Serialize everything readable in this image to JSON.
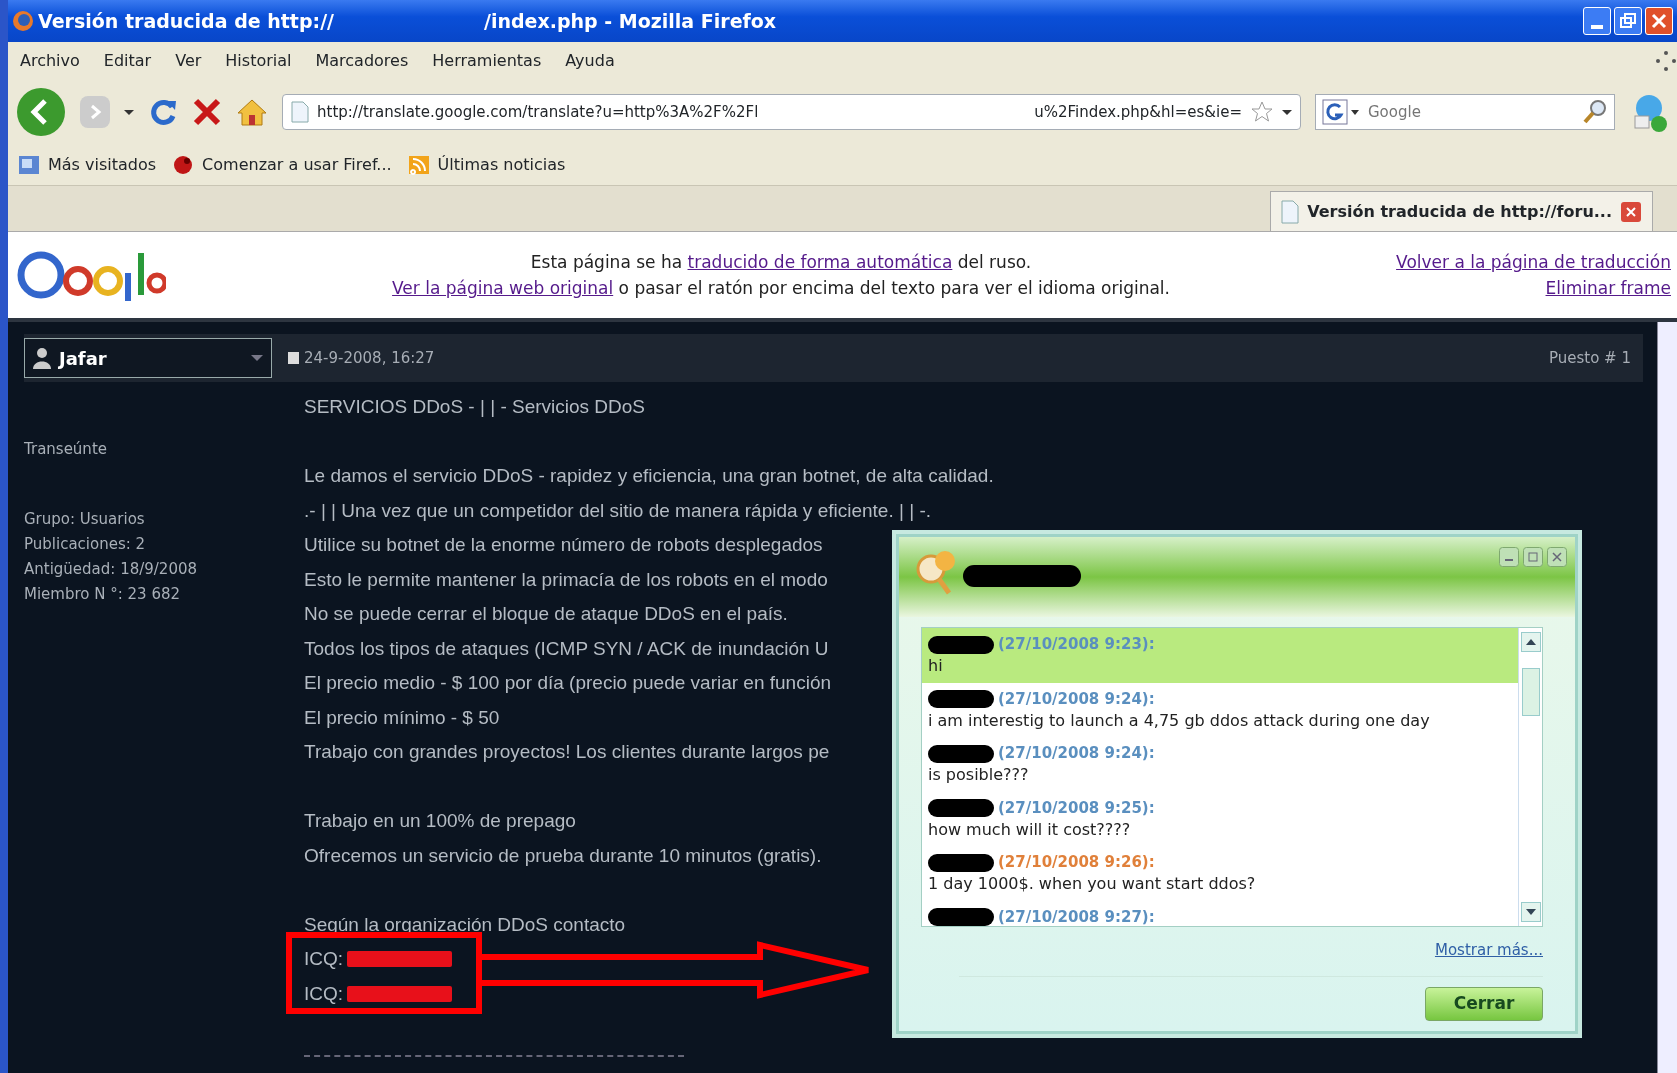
{
  "window": {
    "title_start": "Versión traducida de http://",
    "title_end": "/index.php - Mozilla Firefox"
  },
  "menu": [
    "Archivo",
    "Editar",
    "Ver",
    "Historial",
    "Marcadores",
    "Herramientas",
    "Ayuda"
  ],
  "toolbar": {
    "url_start": "http://translate.google.com/translate?u=http%3A%2F%2Fl",
    "url_end": "u%2Findex.php&hl=es&ie=",
    "search_placeholder": "Google"
  },
  "bookmarks": [
    "Más visitados",
    "Comenzar a usar Firef...",
    "Últimas noticias"
  ],
  "tabs": [
    {
      "label": "Versión traducida de http://foru...",
      "selected": true
    }
  ],
  "google_bar": {
    "line1_before": "Esta página se ha ",
    "line1_link": "traducido de forma automática",
    "line1_after": " del ruso.",
    "line2_link": "Ver la página web original",
    "line2_after": " o pasar el ratón por encima del texto para ver el idioma original.",
    "links": [
      "Volver a la página de traducción",
      "Eliminar frame"
    ]
  },
  "post": {
    "author": "Jafar",
    "date": "24-9-2008, 16:27",
    "number": "Puesto # 1",
    "rank": "Transeúnte",
    "details": [
      "Grupo: Usuarios",
      "Publicaciones: 2",
      "Antigüedad: 18/9/2008",
      "Miembro N °: 23 682"
    ],
    "paragraphs": [
      [
        {
          "kind": "text",
          "text": "SERVICIOS DDoS - | | - Servicios DDoS"
        }
      ],
      [
        {
          "kind": "text",
          "text": "Le damos el servicio DDoS - rapidez y eficiencia, una gran botnet, de alta calidad."
        },
        {
          "kind": "text",
          "text": ".- | | Una vez que un competidor del sitio de manera rápida y eficiente. | | -."
        },
        {
          "kind": "text",
          "text": "Utilice su botnet de la enorme número de robots desplegados"
        },
        {
          "kind": "text",
          "text": "Esto le permite mantener la primacía de los robots en el modo"
        },
        {
          "kind": "text",
          "text": "No se puede cerrar el bloque de ataque DDoS en el país."
        },
        {
          "kind": "text",
          "text": "Todos los tipos de ataques (ICMP SYN / ACK de inundación U"
        },
        {
          "kind": "text",
          "text": "El precio medio - $ 100 por día (precio puede variar en función"
        },
        {
          "kind": "text",
          "text": "El precio mínimo - $ 50"
        },
        {
          "kind": "text",
          "text": "Trabajo con grandes proyectos! Los clientes durante largos pe"
        }
      ],
      [
        {
          "kind": "text",
          "text": "Trabajo en un 100% de prepago"
        },
        {
          "kind": "text",
          "text": "Ofrecemos un servicio de prueba durante 10 minutos (gratis)."
        }
      ],
      [
        {
          "kind": "text",
          "text": "Según la organización DDoS contacto"
        },
        {
          "kind": "icq",
          "text": "ICQ:"
        },
        {
          "kind": "icq",
          "text": "ICQ:"
        }
      ]
    ]
  },
  "chat": {
    "messages": [
      {
        "time": "(27/10/2008 9:23):",
        "text": "hi",
        "color": "#5a8fbf",
        "selected": true
      },
      {
        "time": "(27/10/2008 9:24):",
        "text": "i am interestig to launch a 4,75 gb ddos attack during one day",
        "color": "#5a8fbf",
        "selected": false
      },
      {
        "time": "(27/10/2008 9:24):",
        "text": "is posible???",
        "color": "#5a8fbf",
        "selected": false
      },
      {
        "time": "(27/10/2008 9:25):",
        "text": "how much will it cost????",
        "color": "#5a8fbf",
        "selected": false
      },
      {
        "time": "(27/10/2008 9:26):",
        "text": "1 day 1000$. when you want start ddos?",
        "color": "#e0803a",
        "selected": false
      },
      {
        "time": "(27/10/2008 9:27):",
        "color": "#5a8fbf",
        "selected": false
      }
    ],
    "more_link": "Mostrar más...",
    "close_button": "Cerrar"
  }
}
